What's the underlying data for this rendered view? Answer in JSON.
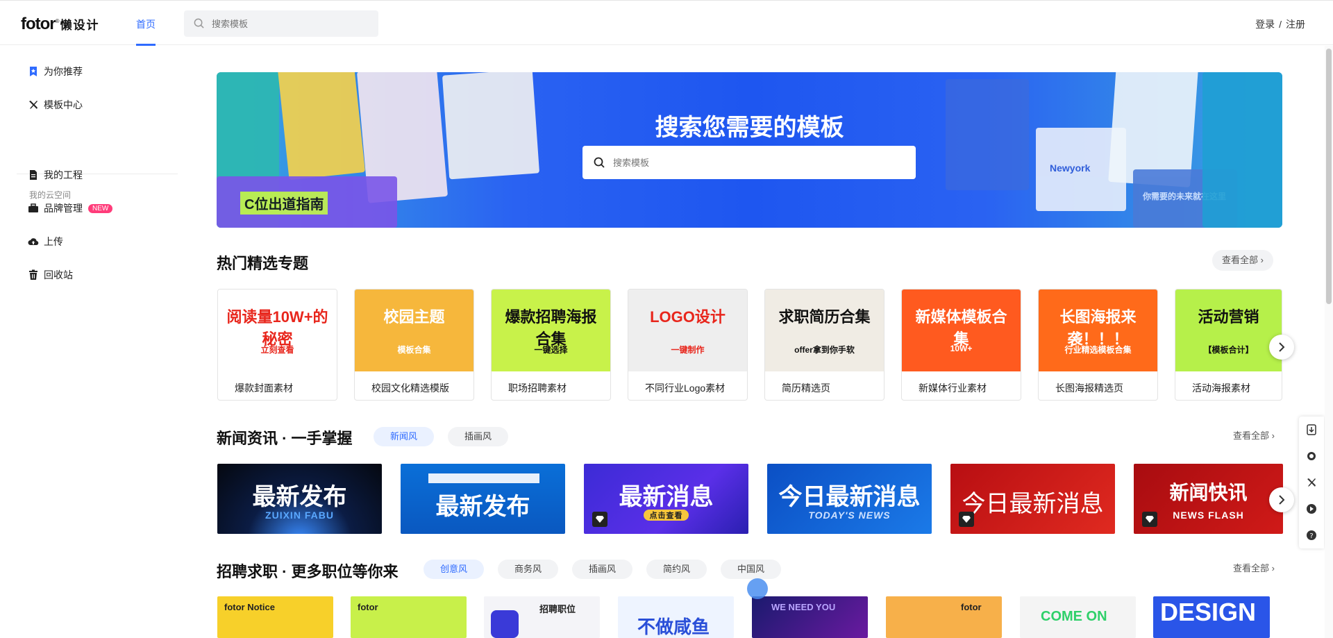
{
  "brand": {
    "name": "fotor",
    "reg": "®",
    "sub": "懒设计"
  },
  "nav": {
    "home": "首页",
    "search_placeholder": "搜索模板",
    "login": "登录",
    "sep": "/",
    "register": "注册"
  },
  "sidebar": {
    "items": [
      {
        "label": "为你推荐",
        "icon": "bookmark-icon"
      },
      {
        "label": "模板中心",
        "icon": "tools-icon"
      }
    ],
    "group": "我的云空间",
    "cloud": [
      {
        "label": "我的工程",
        "icon": "document-icon"
      },
      {
        "label": "品牌管理",
        "icon": "briefcase-icon",
        "badge": "NEW"
      },
      {
        "label": "上传",
        "icon": "cloud-upload-icon"
      },
      {
        "label": "回收站",
        "icon": "trash-icon"
      }
    ]
  },
  "hero": {
    "title": "搜索您需要的模板",
    "placeholder": "搜索模板",
    "art": {
      "left": "C位出道指南",
      "right": "你需要的未来就在这里",
      "brand": "Newyork"
    }
  },
  "topics": {
    "title": "热门精选专题",
    "view_all": "查看全部",
    "items": [
      {
        "caption": "爆款封面素材",
        "art": "阅读量10W+的秘密",
        "sub": "立刻查看",
        "bg": "#ffffff",
        "fg": "#e8261c"
      },
      {
        "caption": "校园文化精选模版",
        "art": "校园主题",
        "sub": "模板合集",
        "bg": "#f6b73c",
        "fg": "#ffffff"
      },
      {
        "caption": "职场招聘素材",
        "art": "爆款招聘海报合集",
        "sub": "一键选择",
        "bg": "#c8f24a",
        "fg": "#111111"
      },
      {
        "caption": "不同行业Logo素材",
        "art": "LOGO设计",
        "sub": "一键制作",
        "bg": "#eeeeee",
        "fg": "#e8261c"
      },
      {
        "caption": "简历精选页",
        "art": "求职简历合集",
        "sub": "offer拿到你手软",
        "bg": "#f0ece4",
        "fg": "#111111"
      },
      {
        "caption": "新媒体行业素材",
        "art": "新媒体模板合集",
        "sub": "10W+",
        "bg": "#ff5a1f",
        "fg": "#ffffff"
      },
      {
        "caption": "长图海报精选页",
        "art": "长图海报来袭！！！",
        "sub": "行业精选模板合集",
        "bg": "#ff6a1a",
        "fg": "#ffffff"
      },
      {
        "caption": "活动海报素材",
        "art": "活动营销",
        "sub": "【模板合计】",
        "bg": "#b6f04a",
        "fg": "#111111"
      }
    ]
  },
  "news": {
    "title": "新闻资讯 · 一手掌握",
    "chips": [
      "新闻风",
      "插画风"
    ],
    "view_all": "查看全部",
    "items": [
      {
        "title": "最新发布",
        "sub": "ZUIXIN FABU"
      },
      {
        "title": "最新发布",
        "sub": ""
      },
      {
        "title": "最新消息",
        "sub": "点击查看"
      },
      {
        "title": "今日最新消息",
        "sub": "TODAY'S NEWS"
      },
      {
        "title": "今日最新消息",
        "sub": ""
      },
      {
        "title": "新闻快讯",
        "sub": "NEWS FLASH"
      }
    ]
  },
  "jobs": {
    "title": "招聘求职 · 更多职位等你来",
    "chips": [
      "创意风",
      "商务风",
      "插画风",
      "简约风",
      "中国风"
    ],
    "view_all": "查看全部",
    "items": [
      "fotor Notice",
      "fotor",
      "招聘职位",
      "不做咸鱼",
      "WE NEED YOU",
      "fotor",
      "COME ON",
      "DESIGN"
    ]
  },
  "colors": {
    "accent": "#2f6bff",
    "badge": "#ff3c7a"
  }
}
